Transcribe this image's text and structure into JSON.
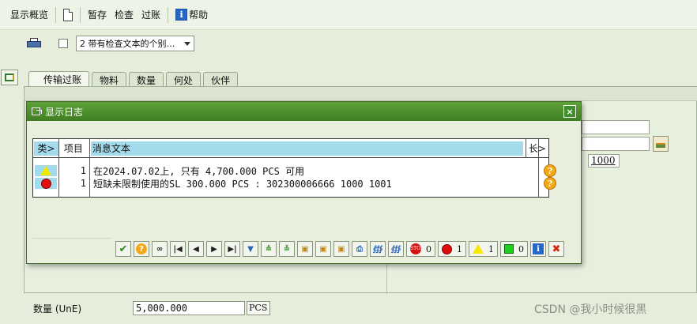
{
  "toolbar": {
    "overview": "显示概览",
    "save": "暂存",
    "check": "检查",
    "post": "过账",
    "help": "帮助"
  },
  "row2": {
    "dropdown_value": "2 带有检查文本的个别…"
  },
  "tabs": [
    {
      "label": "传输过账",
      "active": true
    },
    {
      "label": "物料",
      "active": false
    },
    {
      "label": "数量",
      "active": false
    },
    {
      "label": "何处",
      "active": false
    },
    {
      "label": "伙伴",
      "active": false
    }
  ],
  "right_field_value": "1000",
  "dialog": {
    "title": "显示日志",
    "close": "×",
    "headers": {
      "cls": "类>",
      "item": "项目",
      "text": "消息文本",
      "len": "长>"
    },
    "rows": [
      {
        "type": "warning",
        "item": "1",
        "text": "在2024.07.02上, 只有 4,700.000 PCS 可用"
      },
      {
        "type": "error",
        "item": "1",
        "text": "短缺未限制使用的SL 300.000 PCS : 302300006666 1000 1001"
      }
    ],
    "counts": {
      "stop": "0",
      "error": "1",
      "warning": "1",
      "success": "0"
    }
  },
  "bottom": {
    "label": "数量 (UnE)",
    "value": "5,000.000",
    "unit": "PCS"
  },
  "watermark": "CSDN @我小时候很黑",
  "colors": {
    "dialog_title": "#4e922e",
    "header_highlight": "#a4dbec",
    "background": "#e6eedb"
  }
}
